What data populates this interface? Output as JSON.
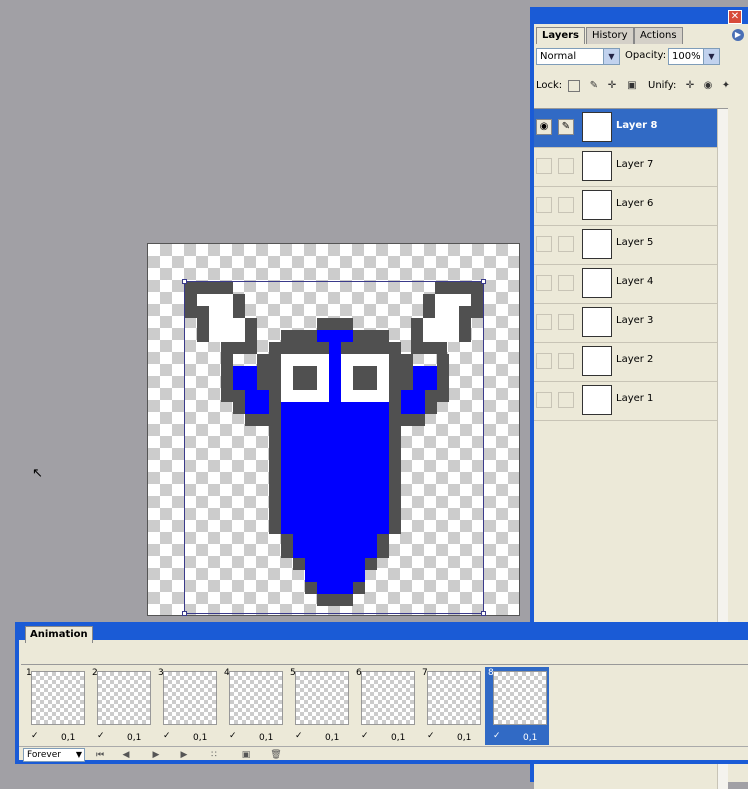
{
  "layers_panel": {
    "tabs": [
      "Layers",
      "History",
      "Actions"
    ],
    "active_tab": "Layers",
    "blend_mode": "Normal",
    "opacity_label": "Opacity:",
    "opacity_value": "100%",
    "lock_label": "Lock:",
    "unify_label": "Unify:",
    "layers": [
      {
        "name": "Layer 8",
        "selected": true
      },
      {
        "name": "Layer 7",
        "selected": false
      },
      {
        "name": "Layer 6",
        "selected": false
      },
      {
        "name": "Layer 5",
        "selected": false
      },
      {
        "name": "Layer 4",
        "selected": false
      },
      {
        "name": "Layer 3",
        "selected": false
      },
      {
        "name": "Layer 2",
        "selected": false
      },
      {
        "name": "Layer 1",
        "selected": false
      }
    ]
  },
  "animation_panel": {
    "title": "Animation",
    "frames": [
      {
        "number": "1",
        "delay": "0,1"
      },
      {
        "number": "2",
        "delay": "0,1"
      },
      {
        "number": "3",
        "delay": "0,1"
      },
      {
        "number": "4",
        "delay": "0,1"
      },
      {
        "number": "5",
        "delay": "0,1"
      },
      {
        "number": "6",
        "delay": "0,1"
      },
      {
        "number": "7",
        "delay": "0,1"
      },
      {
        "number": "8",
        "delay": "0,1"
      }
    ],
    "selected_frame": "8",
    "loop_option": "Forever"
  },
  "colors": {
    "character_blue": "#0000ff",
    "character_gray": "#505050",
    "selection_blue": "#316ac5",
    "titlebar_blue": "#1a5bd6"
  }
}
